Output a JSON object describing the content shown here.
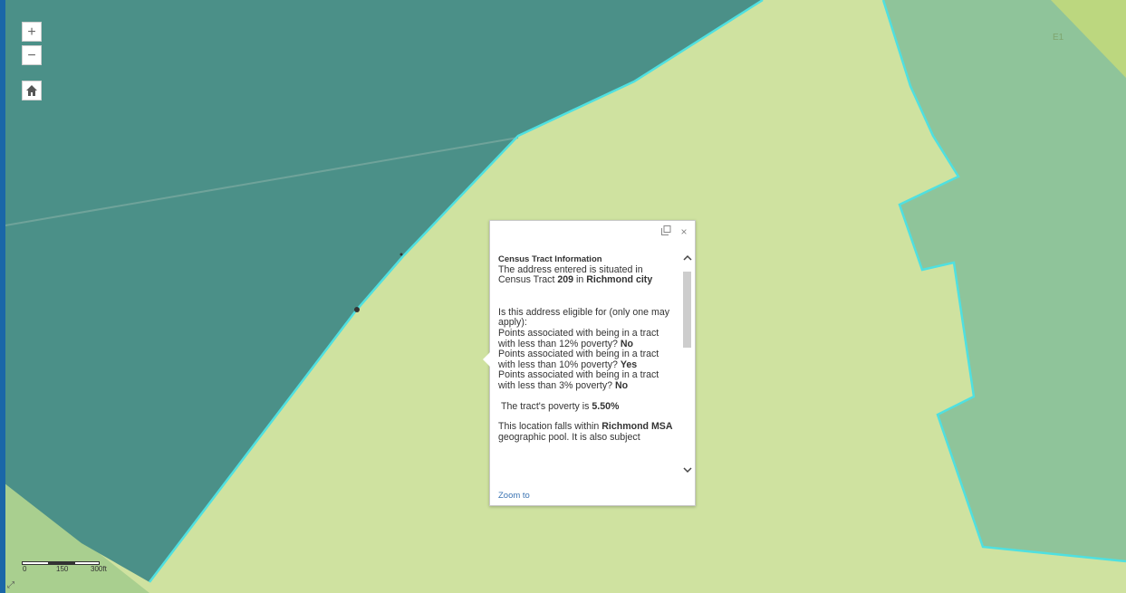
{
  "map": {
    "colors": {
      "background": "#cfe2a0",
      "tract_dark": "#4b9088",
      "tract_mid": "#8fc49a",
      "tract_light": "#cfe2a0",
      "tract_yellow": "#bcd77f",
      "boundary": "#4fe0e0"
    },
    "controls": {
      "zoom_in": "+",
      "zoom_out": "−",
      "home_icon": "home-icon"
    },
    "scale_bar": {
      "labels": [
        "0",
        "150",
        "300ft"
      ]
    },
    "corner_mark": "⤢",
    "tile_label": "E1"
  },
  "popup": {
    "maximize_icon": "maximize-icon",
    "close_icon": "close-icon",
    "title": "Census Tract Information",
    "intro": "The address entered is situated in Census Tract",
    "tract_number": "209",
    "in_text": "in",
    "city": "Richmond city",
    "question": "Is this address eligible for (only one may apply):",
    "items": [
      {
        "text": "Points associated with being in a tract with less than 12% poverty?",
        "answer": "No"
      },
      {
        "text": "Points associated with being in a tract with less than 10% poverty?",
        "answer": "Yes"
      },
      {
        "text": "Points associated with being in a tract with less than 3% poverty?",
        "answer": "No"
      }
    ],
    "poverty_label": "The tract's poverty is",
    "poverty_value": "5.50%",
    "msa_pre": "This location falls within",
    "msa_name": "Richmond MSA",
    "msa_post": "geographic pool. It is also subject",
    "zoom_to": "Zoom to"
  }
}
